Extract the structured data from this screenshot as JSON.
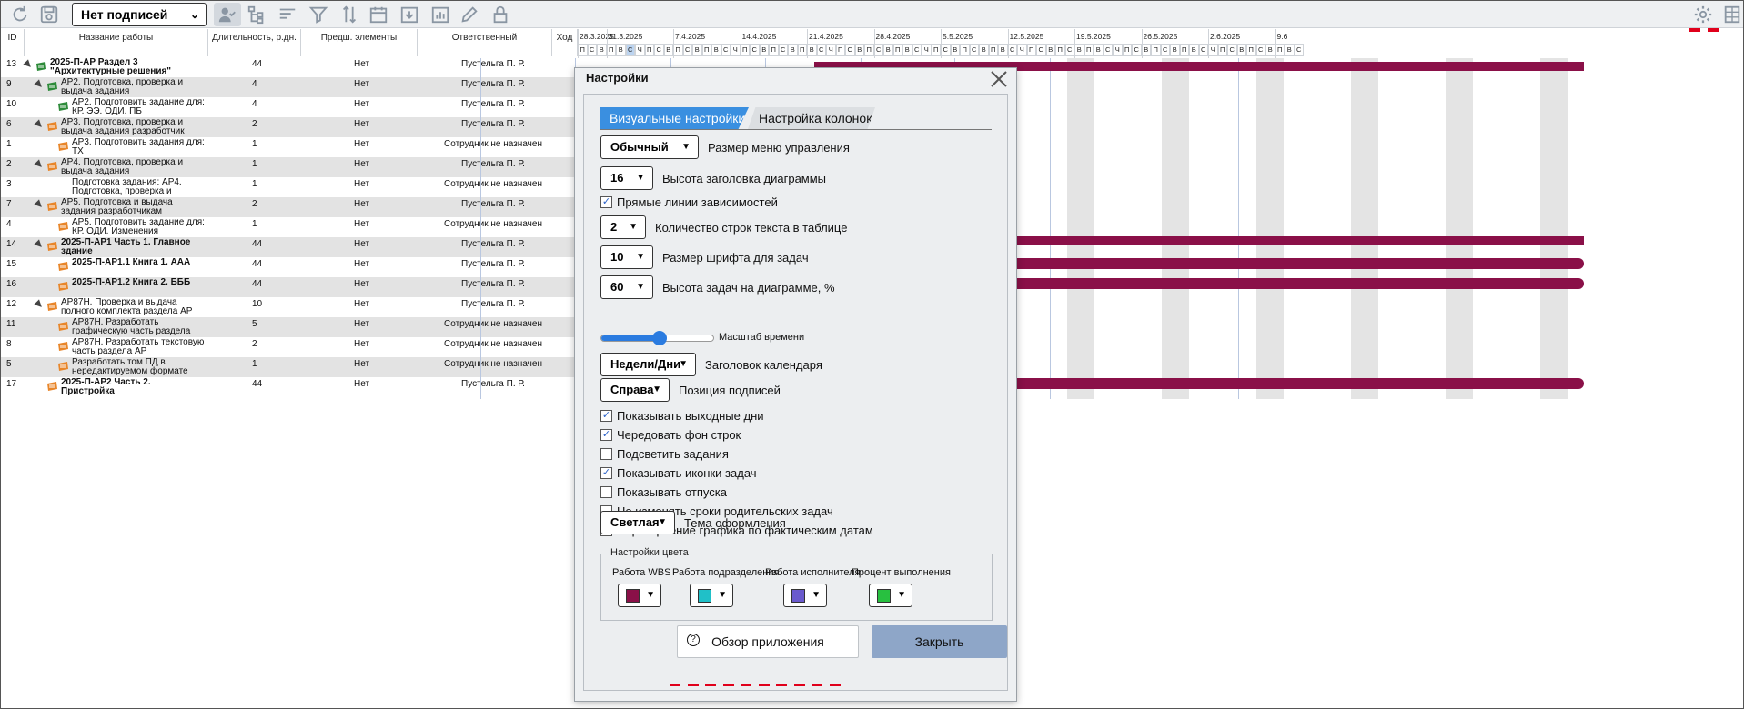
{
  "toolbar": {
    "signatures_select": "Нет подписей"
  },
  "grid": {
    "headers": {
      "id": "ID",
      "name": "Название работы",
      "duration": "Длительность, р.дн.",
      "pred": "Предш. элементы",
      "resp": "Ответственный",
      "progress": "Ход"
    },
    "rows": [
      {
        "id": "13",
        "name": "2025-П-АР Раздел 3 \"Архитектурные решения\"",
        "dur": "44",
        "pred": "Нет",
        "resp": "Пустельга П. Р.",
        "bold": true,
        "indent": 0,
        "expand": true,
        "ico": "green"
      },
      {
        "id": "9",
        "name": "АР2. Подготовка, проверка и выдача задания",
        "dur": "4",
        "pred": "Нет",
        "resp": "Пустельга П. Р.",
        "bold": false,
        "indent": 1,
        "expand": true,
        "ico": "green"
      },
      {
        "id": "10",
        "name": "АР2. Подготовить задание для: КР. ЭЭ. ОДИ. ПБ",
        "dur": "4",
        "pred": "Нет",
        "resp": "Пустельга П. Р.",
        "bold": false,
        "indent": 2,
        "expand": false,
        "ico": "green"
      },
      {
        "id": "6",
        "name": "АР3. Подготовка, проверка и выдача задания разработчик",
        "dur": "2",
        "pred": "Нет",
        "resp": "Пустельга П. Р.",
        "bold": false,
        "indent": 1,
        "expand": true,
        "ico": "orange"
      },
      {
        "id": "1",
        "name": "АР3. Подготовить задания для: ТХ",
        "dur": "1",
        "pred": "Нет",
        "resp": "Сотрудник не назначен",
        "bold": false,
        "indent": 2,
        "expand": false,
        "ico": "orange"
      },
      {
        "id": "2",
        "name": "АР4. Подготовка, проверка и выдача задания",
        "dur": "1",
        "pred": "Нет",
        "resp": "Пустельга П. Р.",
        "bold": false,
        "indent": 1,
        "expand": true,
        "ico": "orange"
      },
      {
        "id": "3",
        "name": "Подготовка задания: АР4. Подготовка, проверка и",
        "dur": "1",
        "pred": "Нет",
        "resp": "Сотрудник не назначен",
        "bold": false,
        "indent": 2,
        "expand": false,
        "ico": "none"
      },
      {
        "id": "7",
        "name": "АР5. Подготовка и выдача задания разработчикам",
        "dur": "2",
        "pred": "Нет",
        "resp": "Пустельга П. Р.",
        "bold": false,
        "indent": 1,
        "expand": true,
        "ico": "orange"
      },
      {
        "id": "4",
        "name": "АР5. Подготовить задание для: КР. ОДИ. Изменения",
        "dur": "1",
        "pred": "Нет",
        "resp": "Сотрудник не назначен",
        "bold": false,
        "indent": 2,
        "expand": false,
        "ico": "orange"
      },
      {
        "id": "14",
        "name": "2025-П-АР1 Часть 1. Главное здание",
        "dur": "44",
        "pred": "Нет",
        "resp": "Пустельга П. Р.",
        "bold": true,
        "indent": 1,
        "expand": true,
        "ico": "orange"
      },
      {
        "id": "15",
        "name": "2025-П-АР1.1 Книга 1. ААА",
        "dur": "44",
        "pred": "Нет",
        "resp": "Пустельга П. Р.",
        "bold": true,
        "indent": 2,
        "expand": false,
        "ico": "orange"
      },
      {
        "id": "16",
        "name": "2025-П-АР1.2 Книга 2. БББ",
        "dur": "44",
        "pred": "Нет",
        "resp": "Пустельга П. Р.",
        "bold": true,
        "indent": 2,
        "expand": false,
        "ico": "orange"
      },
      {
        "id": "12",
        "name": "АР87Н. Проверка и выдача полного комплекта раздела АР",
        "dur": "10",
        "pred": "Нет",
        "resp": "Пустельга П. Р.",
        "bold": false,
        "indent": 1,
        "expand": true,
        "ico": "orange"
      },
      {
        "id": "11",
        "name": "АР87Н. Разработать графическую часть раздела",
        "dur": "5",
        "pred": "Нет",
        "resp": "Сотрудник не назначен",
        "bold": false,
        "indent": 2,
        "expand": false,
        "ico": "orange"
      },
      {
        "id": "8",
        "name": "АР87Н. Разработать текстовую часть раздела АР",
        "dur": "2",
        "pred": "Нет",
        "resp": "Сотрудник не назначен",
        "bold": false,
        "indent": 2,
        "expand": false,
        "ico": "orange"
      },
      {
        "id": "5",
        "name": "Разработать том ПД в нередактируемом формате",
        "dur": "1",
        "pred": "Нет",
        "resp": "Сотрудник не назначен",
        "bold": false,
        "indent": 2,
        "expand": false,
        "ico": "orange"
      },
      {
        "id": "17",
        "name": "2025-П-АР2 Часть 2. Пристройка",
        "dur": "44",
        "pred": "Нет",
        "resp": "Пустельга П. Р.",
        "bold": true,
        "indent": 1,
        "expand": false,
        "ico": "orange"
      }
    ]
  },
  "gantt": {
    "dates": [
      "28.3.2025",
      "31.3.2025",
      "7.4.2025",
      "14.4.2025",
      "21.4.2025",
      "28.4.2025",
      "5.5.2025",
      "12.5.2025",
      "19.5.2025",
      "26.5.2025",
      "2.6.2025",
      "9.6"
    ],
    "day_letters": [
      "П",
      "С",
      "В",
      "П",
      "В",
      "С",
      "Ч",
      "П",
      "С",
      "В"
    ],
    "bar_color": "#8a1048"
  },
  "dialog": {
    "title": "Настройки",
    "tab_visual": "Визуальные настройки",
    "tab_columns": "Настройка колонок",
    "menu_size_value": "Обычный",
    "menu_size_label": "Размер меню управления",
    "header_height_value": "16",
    "header_height_label": "Высота заголовка диаграммы",
    "straight_lines_label": "Прямые линии зависимостей",
    "text_rows_value": "2",
    "text_rows_label": "Количество строк текста в таблице",
    "font_size_value": "10",
    "font_size_label": "Размер шрифта для задач",
    "task_height_value": "60",
    "task_height_label": "Высота задач на диаграмме, %",
    "time_scale_label": "Масштаб времени",
    "time_scale_value": 0.5,
    "calendar_value": "Недели/Дни",
    "calendar_label": "Заголовок календаря",
    "labels_pos_value": "Справа",
    "labels_pos_label": "Позиция подписей",
    "checks": [
      {
        "label": "Показывать выходные дни",
        "checked": true
      },
      {
        "label": "Чередовать фон строк",
        "checked": true
      },
      {
        "label": "Подсветить задания",
        "checked": false
      },
      {
        "label": "Показывать иконки задач",
        "checked": true
      },
      {
        "label": "Показывать отпуска",
        "checked": false
      },
      {
        "label": "Не изменять сроки родительских задач",
        "checked": false
      },
      {
        "label": "Перестроение графика по фактическим датам",
        "checked": false
      }
    ],
    "theme_value": "Светлая",
    "theme_label": "Тема оформления",
    "colors_legend": "Настройки цвета",
    "colors": [
      {
        "label": "Работа WBS",
        "color": "#8a1048"
      },
      {
        "label": "Работа подразделения",
        "color": "#20c0c8"
      },
      {
        "label": "Работа исполнителя",
        "color": "#6a5acd"
      },
      {
        "label": "Процент выполнения",
        "color": "#28c040"
      }
    ],
    "overview_button": "Обзор приложения",
    "close_button": "Закрыть"
  }
}
